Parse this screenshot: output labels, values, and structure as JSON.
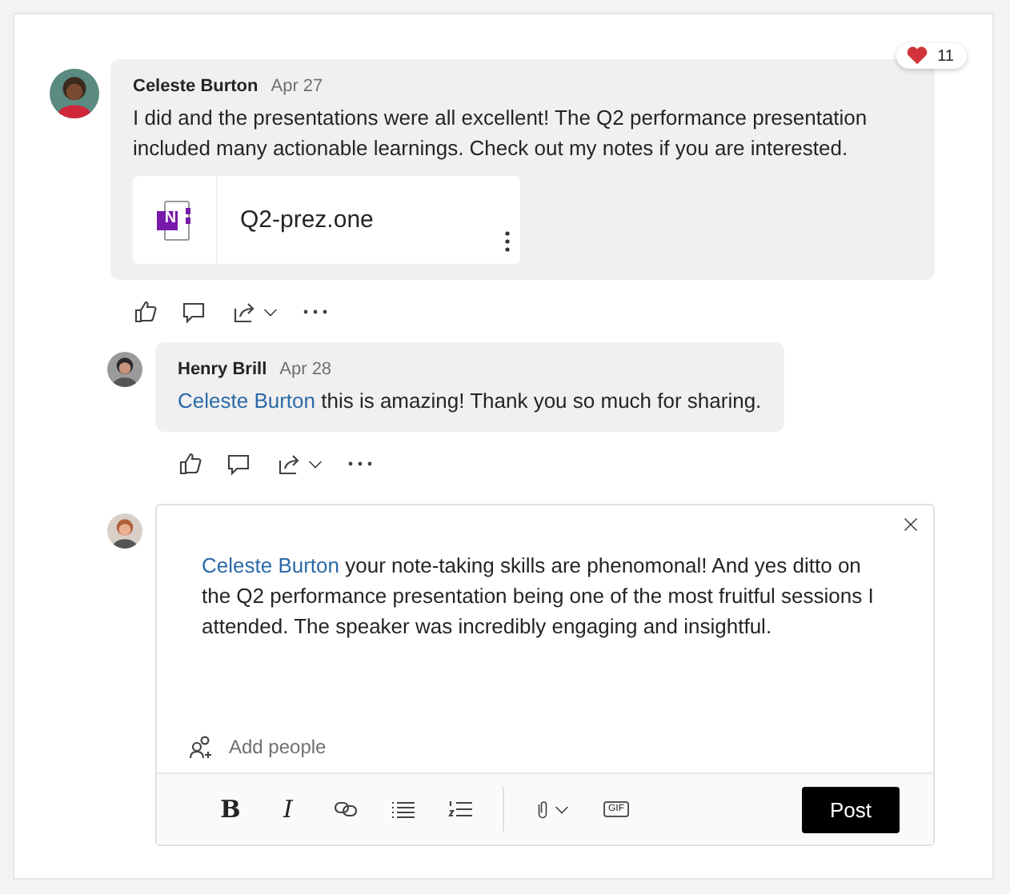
{
  "post": {
    "author": "Celeste Burton",
    "date": "Apr 27",
    "text": "I did and the presentations were all excellent! The Q2 performance presentation included many actionable learnings. Check out my notes if you are interested.",
    "attachment": {
      "name": "Q2-prez.one",
      "app_letter": "N"
    },
    "reaction": {
      "count": "11"
    }
  },
  "reply": {
    "author": "Henry Brill",
    "date": "Apr 28",
    "mention": "Celeste Burton",
    "text": " this is amazing! Thank you so much for sharing."
  },
  "composer": {
    "mention": "Celeste Burton",
    "value": " your note-taking skills are phenomonal! And yes ditto on the Q2 performance presentation being one of the most fruitful sessions I attended. The speaker was incredibly engaging and insightful.",
    "add_people": "Add people",
    "toolbar": [
      {
        "kind": "bold",
        "label": "B"
      },
      {
        "kind": "italic",
        "label": "I"
      },
      {
        "kind": "link"
      },
      {
        "kind": "bullets"
      },
      {
        "kind": "numbers"
      },
      {
        "kind": "divider"
      },
      {
        "kind": "attach"
      },
      {
        "kind": "gif",
        "label": "GIF"
      }
    ],
    "post_button": "Post"
  }
}
